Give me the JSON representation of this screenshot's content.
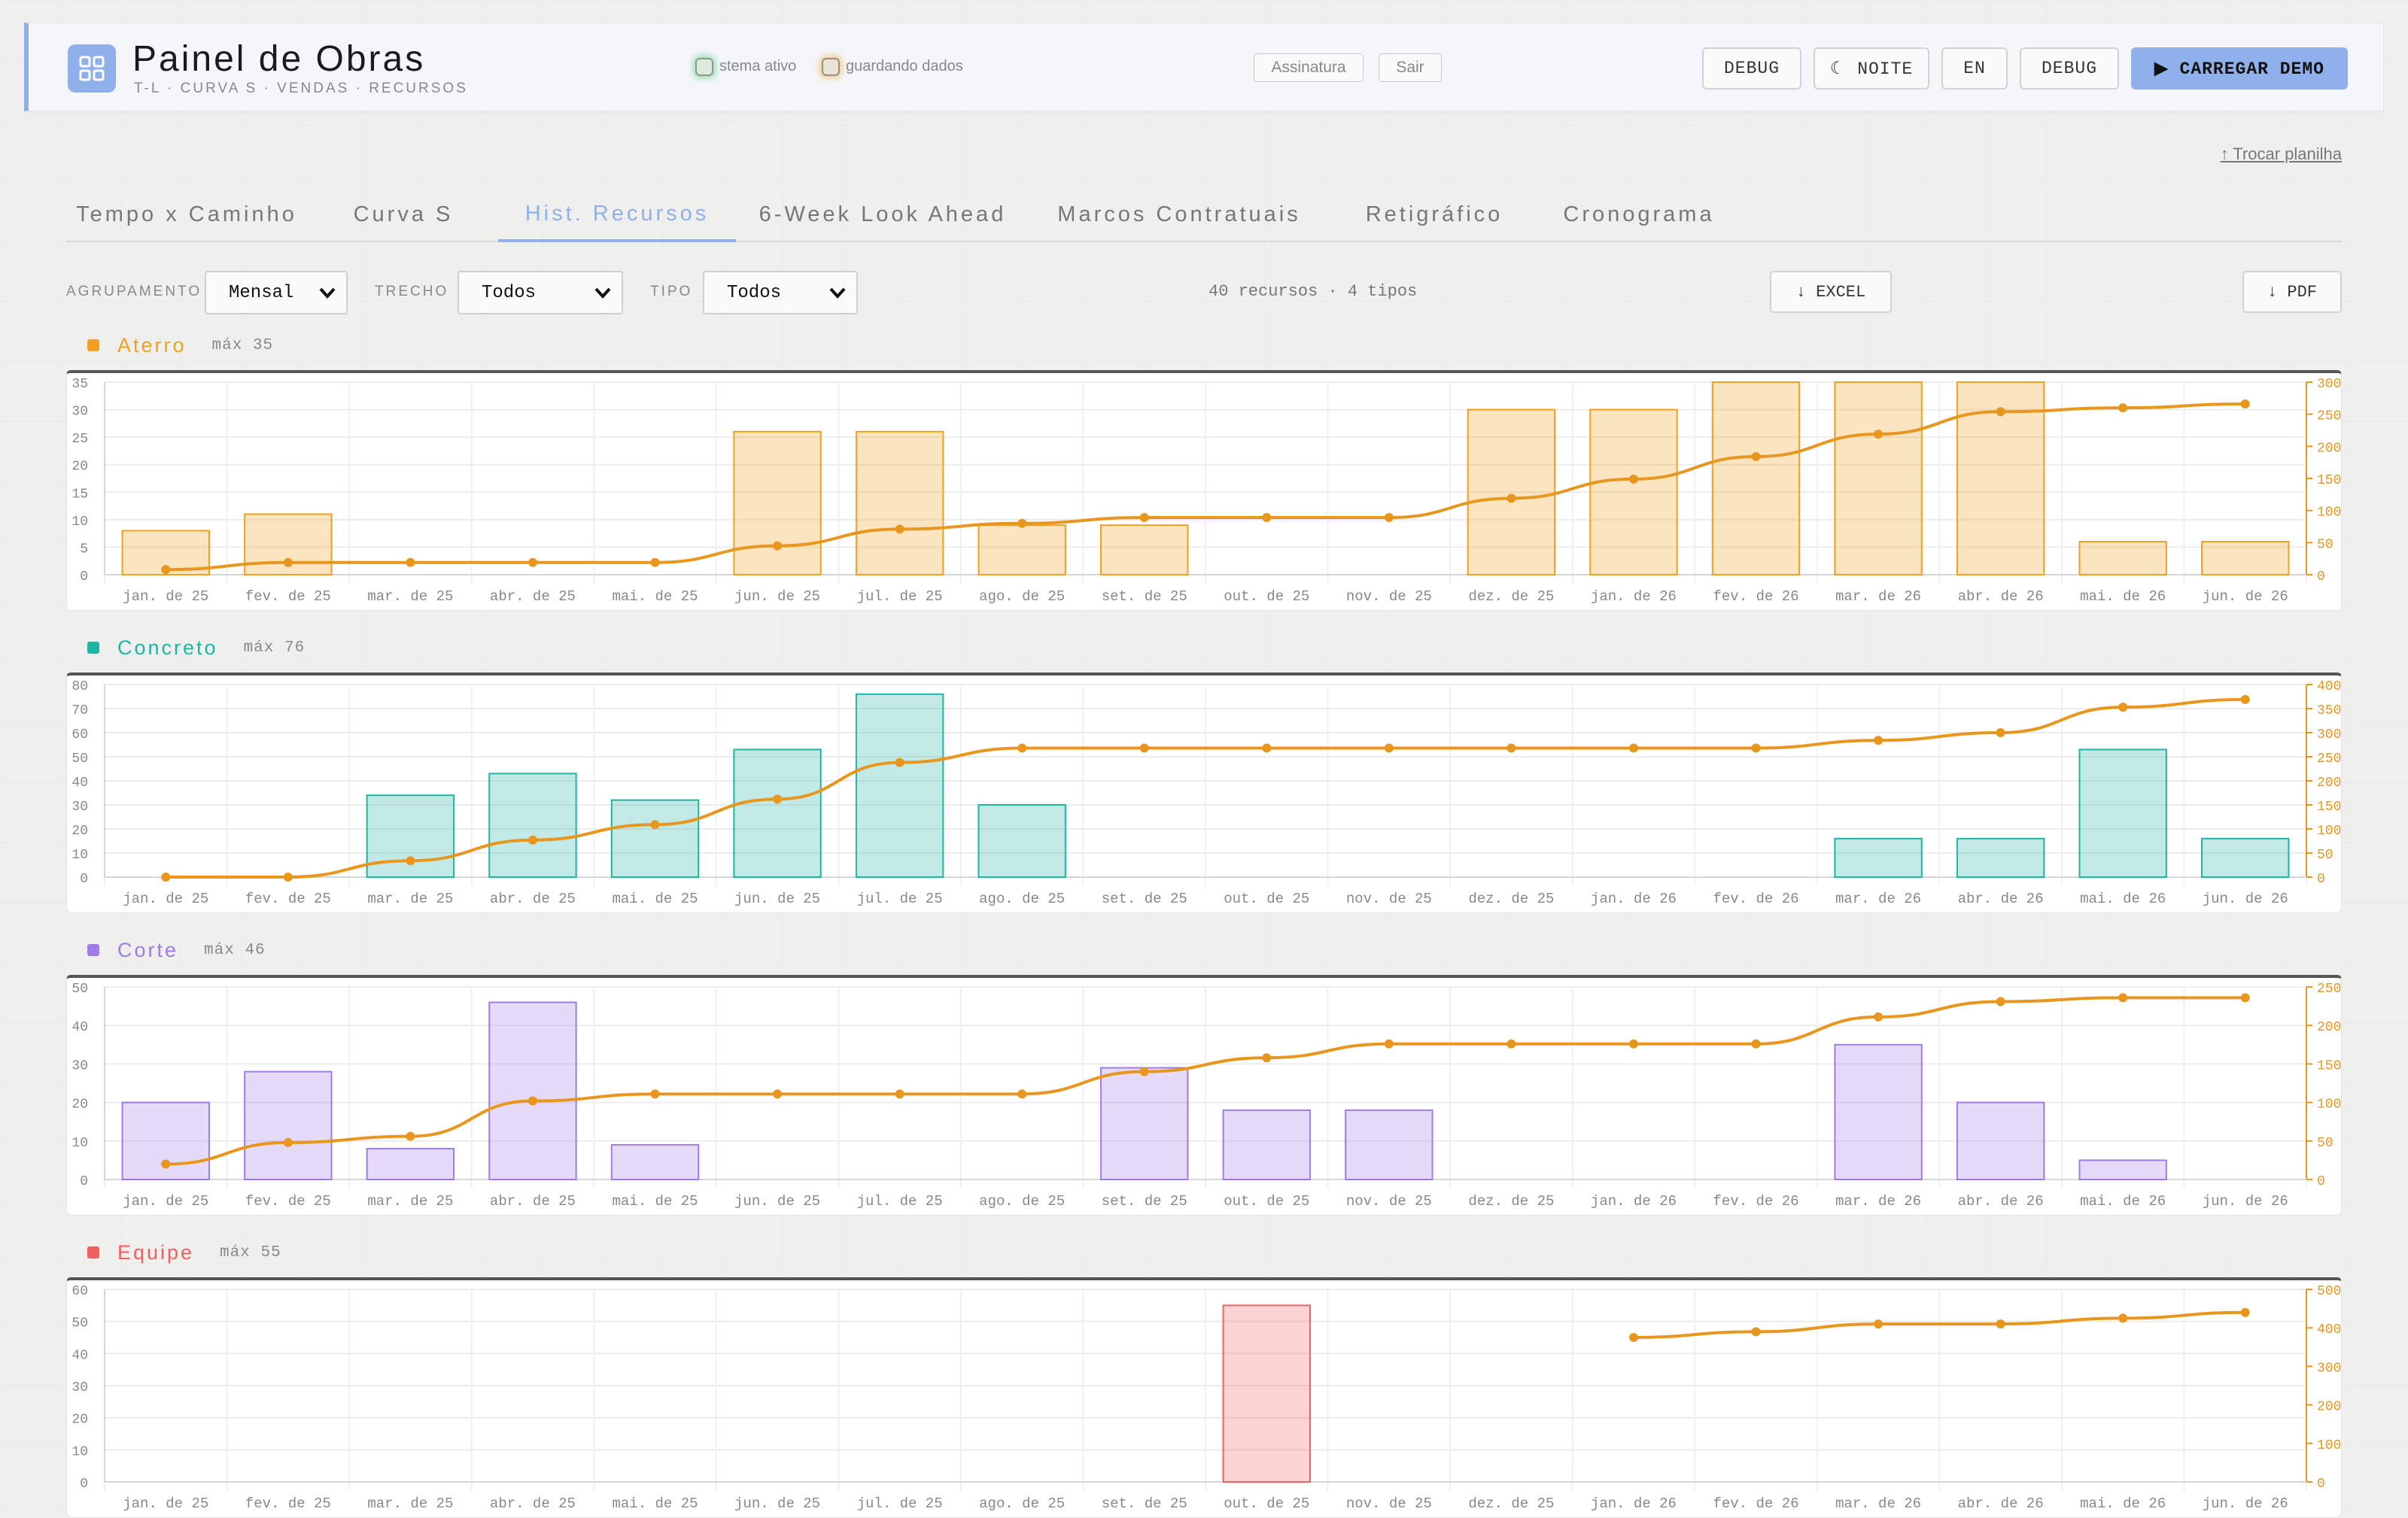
{
  "app": {
    "title": "Painel de Obras",
    "subtitle": "T-L · CURVA S · VENDAS · RECURSOS",
    "status_active": "stema ativo",
    "status_saving": "guardando dados"
  },
  "header": {
    "assinatura_label": "Assinatura",
    "sair_label": "Sair",
    "debug_label_1": "DEBUG",
    "noite_label": "☾ NOITE",
    "lang_label": "EN",
    "debug_label_2": "DEBUG",
    "demo_label": "▶ CARREGAR DEMO"
  },
  "swap_link": "↑ Trocar planilha",
  "tabs": [
    {
      "label": "Tempo x Caminho",
      "active": false
    },
    {
      "label": "Curva S",
      "active": false
    },
    {
      "label": "Hist. Recursos",
      "active": true
    },
    {
      "label": "6-Week Look Ahead",
      "active": false
    },
    {
      "label": "Marcos Contratuais",
      "active": false
    },
    {
      "label": "Retigráfico",
      "active": false
    },
    {
      "label": "Cronograma",
      "active": false
    }
  ],
  "filters": {
    "group_label": "AGRUPAMENTO",
    "group_value": "Mensal",
    "trecho_label": "TRECHO",
    "trecho_value": "Todos",
    "tipo_label": "TIPO",
    "tipo_value": "Todos",
    "summary": "40 recursos · 4 tipos",
    "excel_label": "↓ EXCEL",
    "pdf_label": "↓ PDF"
  },
  "colors": {
    "accent": "#8fb0ea",
    "curve": "#e8961e",
    "aterro": "#f0a020",
    "concreto": "#1fb5a5",
    "corte": "#a07ce8",
    "equipe": "#f06060"
  },
  "chart_data": [
    {
      "type": "bar",
      "title": "Aterro",
      "max_label": "máx 35",
      "color": "#f0a020",
      "categories": [
        "jan. de 25",
        "fev. de 25",
        "mar. de 25",
        "abr. de 25",
        "mai. de 25",
        "jun. de 25",
        "jul. de 25",
        "ago. de 25",
        "set. de 25",
        "out. de 25",
        "nov. de 25",
        "dez. de 25",
        "jan. de 26",
        "fev. de 26",
        "mar. de 26",
        "abr. de 26",
        "mai. de 26",
        "jun. de 26"
      ],
      "values": [
        8,
        11,
        0,
        0,
        0,
        26,
        26,
        9,
        9,
        0,
        0,
        30,
        30,
        35,
        35,
        35,
        6,
        6
      ],
      "cumulative": [
        8,
        19,
        19,
        19,
        19,
        45,
        71,
        80,
        89,
        89,
        89,
        119,
        149,
        184,
        219,
        254,
        260,
        266
      ],
      "ylim": [
        0,
        35
      ],
      "yticks": [
        0,
        5,
        10,
        15,
        20,
        25,
        30,
        35
      ],
      "y2lim": [
        0,
        300
      ],
      "y2ticks": [
        0,
        50,
        100,
        150,
        200,
        250,
        300
      ]
    },
    {
      "type": "bar",
      "title": "Concreto",
      "max_label": "máx 76",
      "color": "#1fb5a5",
      "categories": [
        "jan. de 25",
        "fev. de 25",
        "mar. de 25",
        "abr. de 25",
        "mai. de 25",
        "jun. de 25",
        "jul. de 25",
        "ago. de 25",
        "set. de 25",
        "out. de 25",
        "nov. de 25",
        "dez. de 25",
        "jan. de 26",
        "fev. de 26",
        "mar. de 26",
        "abr. de 26",
        "mai. de 26",
        "jun. de 26"
      ],
      "values": [
        0,
        0,
        34,
        43,
        32,
        53,
        76,
        30,
        0,
        0,
        0,
        0,
        0,
        0,
        16,
        16,
        53,
        16
      ],
      "cumulative": [
        0,
        0,
        34,
        77,
        109,
        162,
        238,
        268,
        268,
        268,
        268,
        268,
        268,
        268,
        284,
        300,
        353,
        369
      ],
      "ylim": [
        0,
        80
      ],
      "yticks": [
        0,
        10,
        20,
        30,
        40,
        50,
        60,
        70,
        80
      ],
      "y2lim": [
        0,
        400
      ],
      "y2ticks": [
        0,
        50,
        100,
        150,
        200,
        250,
        300,
        350,
        400
      ]
    },
    {
      "type": "bar",
      "title": "Corte",
      "max_label": "máx 46",
      "color": "#a07ce8",
      "categories": [
        "jan. de 25",
        "fev. de 25",
        "mar. de 25",
        "abr. de 25",
        "mai. de 25",
        "jun. de 25",
        "jul. de 25",
        "ago. de 25",
        "set. de 25",
        "out. de 25",
        "nov. de 25",
        "dez. de 25",
        "jan. de 26",
        "fev. de 26",
        "mar. de 26",
        "abr. de 26",
        "mai. de 26",
        "jun. de 26"
      ],
      "values": [
        20,
        28,
        8,
        46,
        9,
        0,
        0,
        0,
        29,
        18,
        18,
        0,
        0,
        0,
        35,
        20,
        5,
        0
      ],
      "cumulative": [
        20,
        48,
        56,
        102,
        111,
        111,
        111,
        111,
        140,
        158,
        176,
        176,
        176,
        176,
        211,
        231,
        236,
        236
      ],
      "ylim": [
        0,
        50
      ],
      "yticks": [
        0,
        10,
        20,
        30,
        40,
        50
      ],
      "y2lim": [
        0,
        250
      ],
      "y2ticks": [
        0,
        50,
        100,
        150,
        200,
        250
      ]
    },
    {
      "type": "bar",
      "title": "Equipe",
      "max_label": "máx 55",
      "color": "#f06060",
      "categories": [
        "jan. de 25",
        "fev. de 25",
        "mar. de 25",
        "abr. de 25",
        "mai. de 25",
        "jun. de 25",
        "jul. de 25",
        "ago. de 25",
        "set. de 25",
        "out. de 25",
        "nov. de 25",
        "dez. de 25",
        "jan. de 26",
        "fev. de 26",
        "mar. de 26",
        "abr. de 26",
        "mai. de 26",
        "jun. de 26"
      ],
      "values": [
        0,
        0,
        0,
        0,
        0,
        0,
        0,
        0,
        0,
        55,
        0,
        0,
        0,
        0,
        0,
        0,
        0,
        0
      ],
      "cumulative": [
        null,
        null,
        null,
        null,
        null,
        null,
        null,
        null,
        null,
        null,
        null,
        null,
        375,
        390,
        410,
        410,
        425,
        440
      ],
      "ylim": [
        0,
        60
      ],
      "yticks": [
        0,
        10,
        20,
        30,
        40,
        50,
        60
      ],
      "y2lim": [
        0,
        500
      ],
      "y2ticks": [
        0,
        100,
        200,
        300,
        400,
        500
      ]
    }
  ]
}
